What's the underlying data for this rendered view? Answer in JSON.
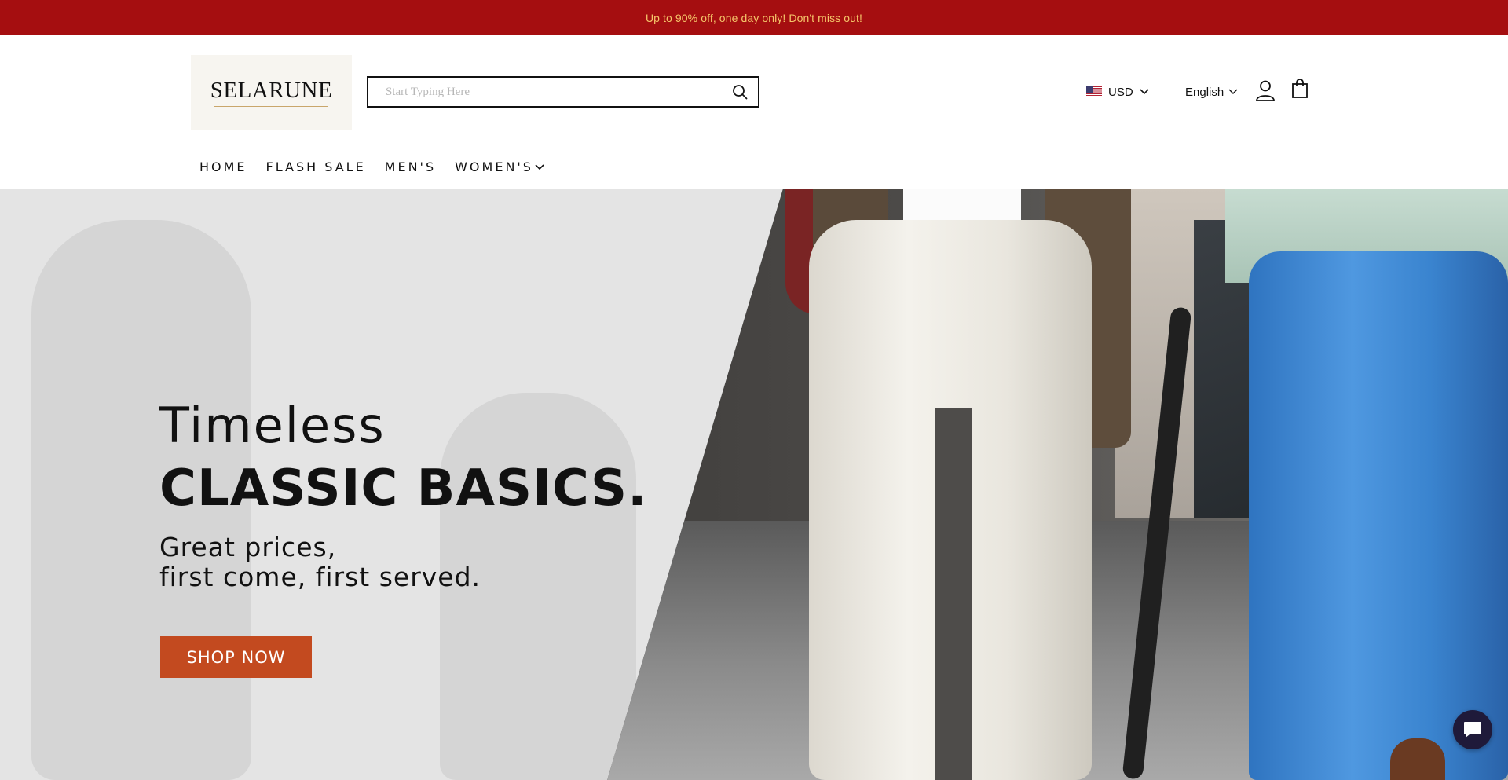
{
  "announcement": {
    "text": "Up to 90% off, one day only! Don't miss out!"
  },
  "brand": {
    "logo_text": "SELARUNE"
  },
  "search": {
    "placeholder": "Start Typing Here",
    "value": ""
  },
  "header": {
    "currency": {
      "flag": "us-flag-icon",
      "label": "USD"
    },
    "language": {
      "label": "English"
    },
    "icons": [
      "search-icon",
      "account-icon",
      "cart-icon",
      "chevron-down-icon"
    ]
  },
  "nav": {
    "items": [
      {
        "label": "HOME"
      },
      {
        "label": "FLASH SALE"
      },
      {
        "label": "MEN'S"
      },
      {
        "label": "WOMEN'S"
      }
    ]
  },
  "hero": {
    "line1": "Timeless",
    "line2": "CLASSIC BASICS.",
    "line3": "Great prices,",
    "line4": "first come, first served.",
    "cta_label": "SHOP NOW"
  },
  "colors": {
    "announcement_bg": "#a50e10",
    "announcement_text": "#f5c66a",
    "cta_bg": "#c34a1f",
    "chat_bg": "#1f1a3a"
  }
}
